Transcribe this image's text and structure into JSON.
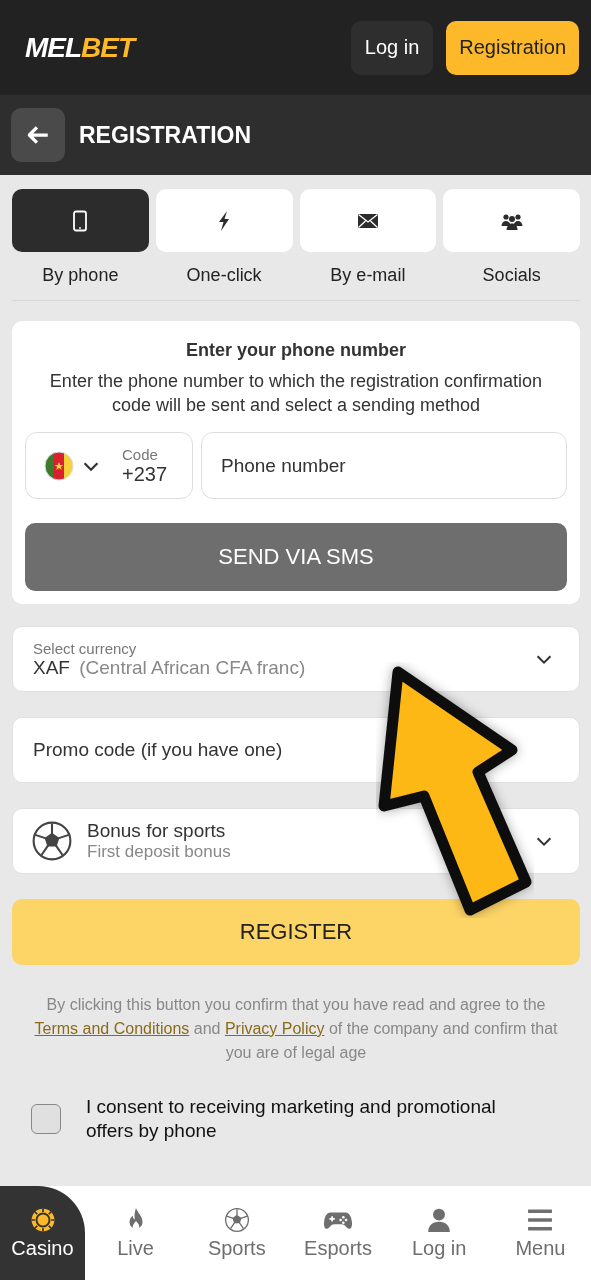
{
  "header": {
    "logo": {
      "text": "MEL",
      "accent": "BET"
    },
    "login": "Log in",
    "register": "Registration"
  },
  "title_bar": {
    "title": "REGISTRATION"
  },
  "tabs": [
    {
      "label": "By phone",
      "selected": true
    },
    {
      "label": "One-click",
      "selected": false
    },
    {
      "label": "By e-mail",
      "selected": false
    },
    {
      "label": "Socials",
      "selected": false
    }
  ],
  "phone_card": {
    "heading": "Enter your phone number",
    "description": "Enter the phone number to which the registration confirmation code will be sent and select a sending method",
    "code_label": "Code",
    "code": "+237",
    "phone_placeholder": "Phone number",
    "send_button": "SEND VIA SMS"
  },
  "currency": {
    "label": "Select currency",
    "code": "XAF",
    "name": "(Central African CFA franc)"
  },
  "promo": {
    "placeholder": "Promo code (if you have one)"
  },
  "bonus": {
    "title": "Bonus for sports",
    "subtitle": "First deposit bonus"
  },
  "register_button": "REGISTER",
  "legal": {
    "before": "By clicking this button you confirm that you have read and agree to the",
    "link_1": "Terms and Conditions",
    "middle": "and",
    "link_2": "Privacy Policy",
    "after": "of the company and confirm that you are of legal age"
  },
  "consent": {
    "label": "I consent to receiving marketing and promotional offers by phone",
    "checked": false
  },
  "bottom_nav": [
    {
      "label": "Casino",
      "selected": true
    },
    {
      "label": "Live",
      "selected": false
    },
    {
      "label": "Sports",
      "selected": false
    },
    {
      "label": "Esports",
      "selected": false
    },
    {
      "label": "Log in",
      "selected": false
    },
    {
      "label": "Menu",
      "selected": false
    }
  ]
}
